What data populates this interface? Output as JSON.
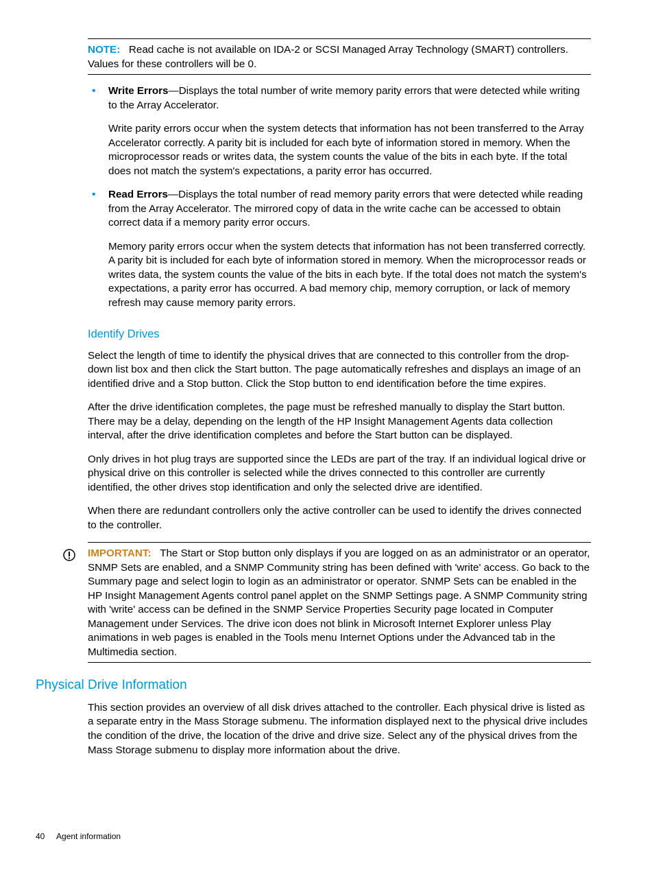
{
  "note": {
    "label": "NOTE:",
    "text": "Read cache is not available on IDA-2 or SCSI Managed Array Technology (SMART) controllers. Values for these controllers will be 0."
  },
  "definitions": [
    {
      "term": "Write Errors",
      "dash": "—",
      "text": "Displays the total number of write memory parity errors that were detected while writing to the Array Accelerator.",
      "extra": "Write parity errors occur when the system detects that information has not been transferred to the Array Accelerator correctly. A parity bit is included for each byte of information stored in memory. When the microprocessor reads or writes data, the system counts the value of the bits in each byte. If the total does not match the system's expectations, a parity error has occurred."
    },
    {
      "term": "Read Errors",
      "dash": "—",
      "text": "Displays the total number of read memory parity errors that were detected while reading from the Array Accelerator. The mirrored copy of data in the write cache can be accessed to obtain correct data if a memory parity error occurs.",
      "extra": "Memory parity errors occur when the system detects that information has not been transferred correctly. A parity bit is included for each byte of information stored in memory. When the microprocessor reads or writes data, the system counts the value of the bits in each byte. If the total does not match the system's expectations, a parity error has occurred. A bad memory chip, memory corruption, or lack of memory refresh may cause memory parity errors."
    }
  ],
  "identify": {
    "heading": "Identify Drives",
    "p1": "Select the length of time to identify the physical drives that are connected to this controller from the drop-down list box and then click the Start button. The page automatically refreshes and displays an image of an identified drive and a Stop button. Click the Stop button to end identification before the time expires.",
    "p2": "After the drive identification completes, the page must be refreshed manually to display the Start button. There may be a delay, depending on the length of the HP Insight Management Agents data collection interval, after the drive identification completes and before the Start button can be displayed.",
    "p3": "Only drives in hot plug trays are supported since the LEDs are part of the tray. If an individual logical drive or physical drive on this controller is selected while the drives connected to this controller are currently identified, the other drives stop identification and only the selected drive are identified.",
    "p4": "When there are redundant controllers only the active controller can be used to identify the drives connected to the controller."
  },
  "important": {
    "label": "IMPORTANT:",
    "text": "The Start or Stop button only displays if you are logged on as an administrator or an operator, SNMP Sets are enabled, and a SNMP Community string has been defined with 'write' access. Go back to the Summary page and select login to login as an administrator or operator. SNMP Sets can be enabled in the HP Insight Management Agents control panel applet on the SNMP Settings page. A SNMP Community string with 'write' access can be defined in the SNMP Service Properties Security page located in Computer Management under Services. The drive icon does not blink in Microsoft Internet Explorer unless Play animations in web pages is enabled in the Tools menu Internet Options under the Advanced tab in the Multimedia section."
  },
  "physical": {
    "heading": "Physical Drive Information",
    "p1": "This section provides an overview of all disk drives attached to the controller. Each physical drive is listed as a separate entry in the Mass Storage submenu. The information displayed next to the physical drive includes the condition of the drive, the location of the drive and drive size. Select any of the physical drives from the Mass Storage submenu to display more information about the drive."
  },
  "footer": {
    "page": "40",
    "section": "Agent information"
  }
}
